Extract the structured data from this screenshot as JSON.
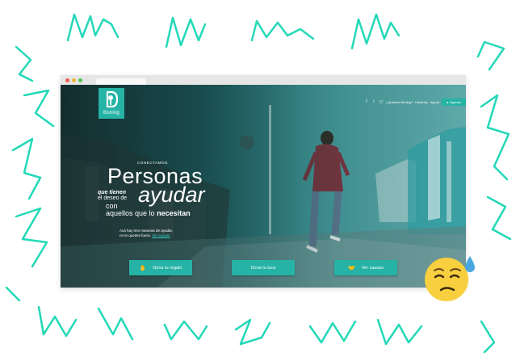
{
  "colors": {
    "teal": "#25b3a5",
    "doodle": "#23d8b8",
    "link": "#38d4c2",
    "emoji_face": "#f8cf3e",
    "sweat_drop": "#4aa6df"
  },
  "browser": {
    "traffic_lights": [
      "close",
      "minimize",
      "maximize"
    ]
  },
  "site": {
    "logo": {
      "mark": "D",
      "name": "Boning"
    },
    "nav": {
      "social_icons": [
        "facebook-icon",
        "twitter-icon",
        "instagram-icon"
      ],
      "links": [
        "¿Quienes Boning?",
        "Historias",
        "Ayuda"
      ],
      "login_label": "Ingresar",
      "login_icon": "user-icon"
    },
    "hero": {
      "eyebrow": "CONECTAMOS",
      "word_personas": "Personas",
      "word_que_tienen": "que tienen",
      "word_el_deseo": "el deseo de",
      "word_ayudar": "ayudar",
      "word_con": "con",
      "word_aquellos": "aquellos que lo",
      "word_necesitan": "necesitan",
      "subtitle_line1": "Acá hay tres maneras de ayudar,",
      "subtitle_line2": "no te quedes fuera.",
      "subtitle_link": "Ver causas"
    },
    "cta": [
      {
        "label": "Dona tu regalo",
        "icon": "gift-hand-icon"
      },
      {
        "label": "Dona tu luca",
        "icon": ""
      },
      {
        "label": "Ver causas",
        "icon": "handshake-icon"
      }
    ]
  },
  "emoji": {
    "icon": "sweat-face-emoji"
  }
}
